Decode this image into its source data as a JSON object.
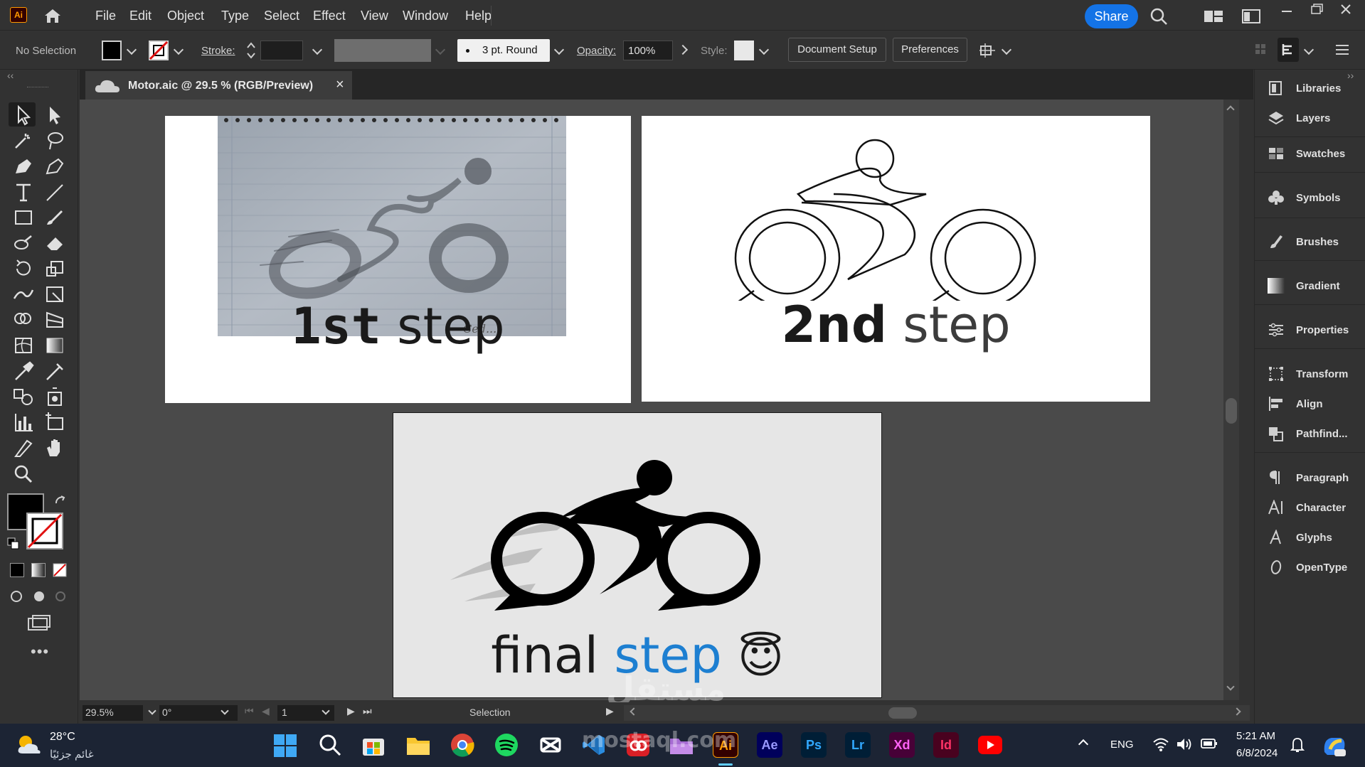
{
  "menubar": {
    "app_logo": "Ai",
    "menus": [
      "File",
      "Edit",
      "Object",
      "Type",
      "Select",
      "Effect",
      "View",
      "Window",
      "Help"
    ],
    "share_label": "Share"
  },
  "controlbar": {
    "selection_status": "No Selection",
    "stroke_label": "Stroke:",
    "brush_label": "3 pt. Round",
    "opacity_label": "Opacity:",
    "opacity_value": "100%",
    "style_label": "Style:",
    "document_setup_label": "Document Setup",
    "preferences_label": "Preferences"
  },
  "document_tab": {
    "title": "Motor.aic @ 29.5 % (RGB/Preview)",
    "close": "×"
  },
  "artboards": {
    "first_step": {
      "number": "1st",
      "word": "step",
      "signature": "Ced..."
    },
    "second_step": {
      "number": "2nd",
      "word": "step"
    },
    "final_step": {
      "first_word": "final",
      "second_word": "step",
      "emoji": "😇"
    }
  },
  "right_panel": {
    "items": [
      "Libraries",
      "Layers",
      "Swatches",
      "Symbols",
      "Brushes",
      "Gradient",
      "Properties",
      "Transform",
      "Align",
      "Pathfind...",
      "Paragraph",
      "Character",
      "Glyphs",
      "OpenType"
    ]
  },
  "statusbar": {
    "zoom": "29.5%",
    "rotation": "0°",
    "artboard_number": "1",
    "tool_name": "Selection"
  },
  "watermark": {
    "arabic": "مستقل",
    "domain": "mostaql.com"
  },
  "taskbar": {
    "weather_temp": "28°C",
    "weather_desc": "غائم جزئيًا",
    "apps": [
      "Ae",
      "Ps",
      "Lr",
      "Xd",
      "Id"
    ],
    "language": "ENG",
    "time": "5:21 AM",
    "date": "6/8/2024"
  },
  "colors": {
    "app_bg": "#323232",
    "canvas_bg": "#4a4a4a",
    "share_blue": "#1473e6",
    "step_blue": "#1d7fd1",
    "ai_orange": "#ff9a00"
  }
}
